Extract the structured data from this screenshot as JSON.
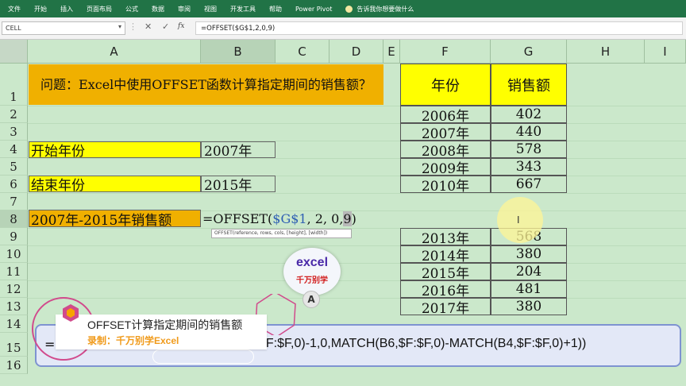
{
  "ribbon": {
    "tabs": [
      "文件",
      "开始",
      "插入",
      "页面布局",
      "公式",
      "数据",
      "审阅",
      "视图",
      "开发工具",
      "帮助",
      "Power Pivot"
    ],
    "tell_me": "告诉我你想要做什么"
  },
  "formula_bar": {
    "name_box": "CELL",
    "cancel": "✕",
    "enter": "✓",
    "fx": "fx",
    "formula": "=OFFSET($G$1,2,0,9)"
  },
  "columns": [
    "A",
    "B",
    "C",
    "D",
    "E",
    "F",
    "G",
    "H",
    "I"
  ],
  "rows": [
    "1",
    "2",
    "3",
    "4",
    "5",
    "6",
    "7",
    "8",
    "9",
    "10",
    "11",
    "12",
    "13",
    "14",
    "15",
    "16"
  ],
  "sheet": {
    "title": "问题：Excel中使用OFFSET函数计算指定期间的销售额？",
    "start_label": "开始年份",
    "start_value": "2007年",
    "end_label": "结束年份",
    "end_value": "2015年",
    "result_label": "2007年-2015年销售额",
    "formula_prefix": "=OFFSET(",
    "formula_ref": "$G$1",
    "formula_args": ", 2, 0, ",
    "formula_last": "9",
    "formula_close": ")",
    "tooltip": "OFFSET(reference, rows, cols, [height], [width])"
  },
  "table": {
    "header_year": "年份",
    "header_sales": "销售额",
    "rows_top": [
      {
        "year": "2006年",
        "sales": "402"
      },
      {
        "year": "2007年",
        "sales": "440"
      },
      {
        "year": "2008年",
        "sales": "578"
      },
      {
        "year": "2009年",
        "sales": "343"
      },
      {
        "year": "2010年",
        "sales": "667"
      }
    ],
    "rows_bottom": [
      {
        "year": "2013年",
        "sales": "568"
      },
      {
        "year": "2014年",
        "sales": "380"
      },
      {
        "year": "2015年",
        "sales": "204"
      },
      {
        "year": "2016年",
        "sales": "481"
      },
      {
        "year": "2017年",
        "sales": "380"
      }
    ]
  },
  "banner": {
    "left": "=S",
    "formula": "$F:$F,0)-1,0,MATCH(B6,$F:$F,0)-MATCH(B4,$F:$F,0)+1))"
  },
  "caption": {
    "title": "OFFSET计算指定期间的销售额",
    "subtitle": "录制：千万别学Excel"
  },
  "logo": {
    "word": "excel",
    "brand": "千万别学",
    "badge": "A"
  },
  "cursor": "I",
  "colors": {
    "ribbon": "#217346",
    "sheet_bg": "#cbe8cb",
    "title_fill": "#f0b000",
    "label_fill": "#ffff00",
    "banner_border": "#7e93d1",
    "caption_accent": "#f09a1a"
  }
}
